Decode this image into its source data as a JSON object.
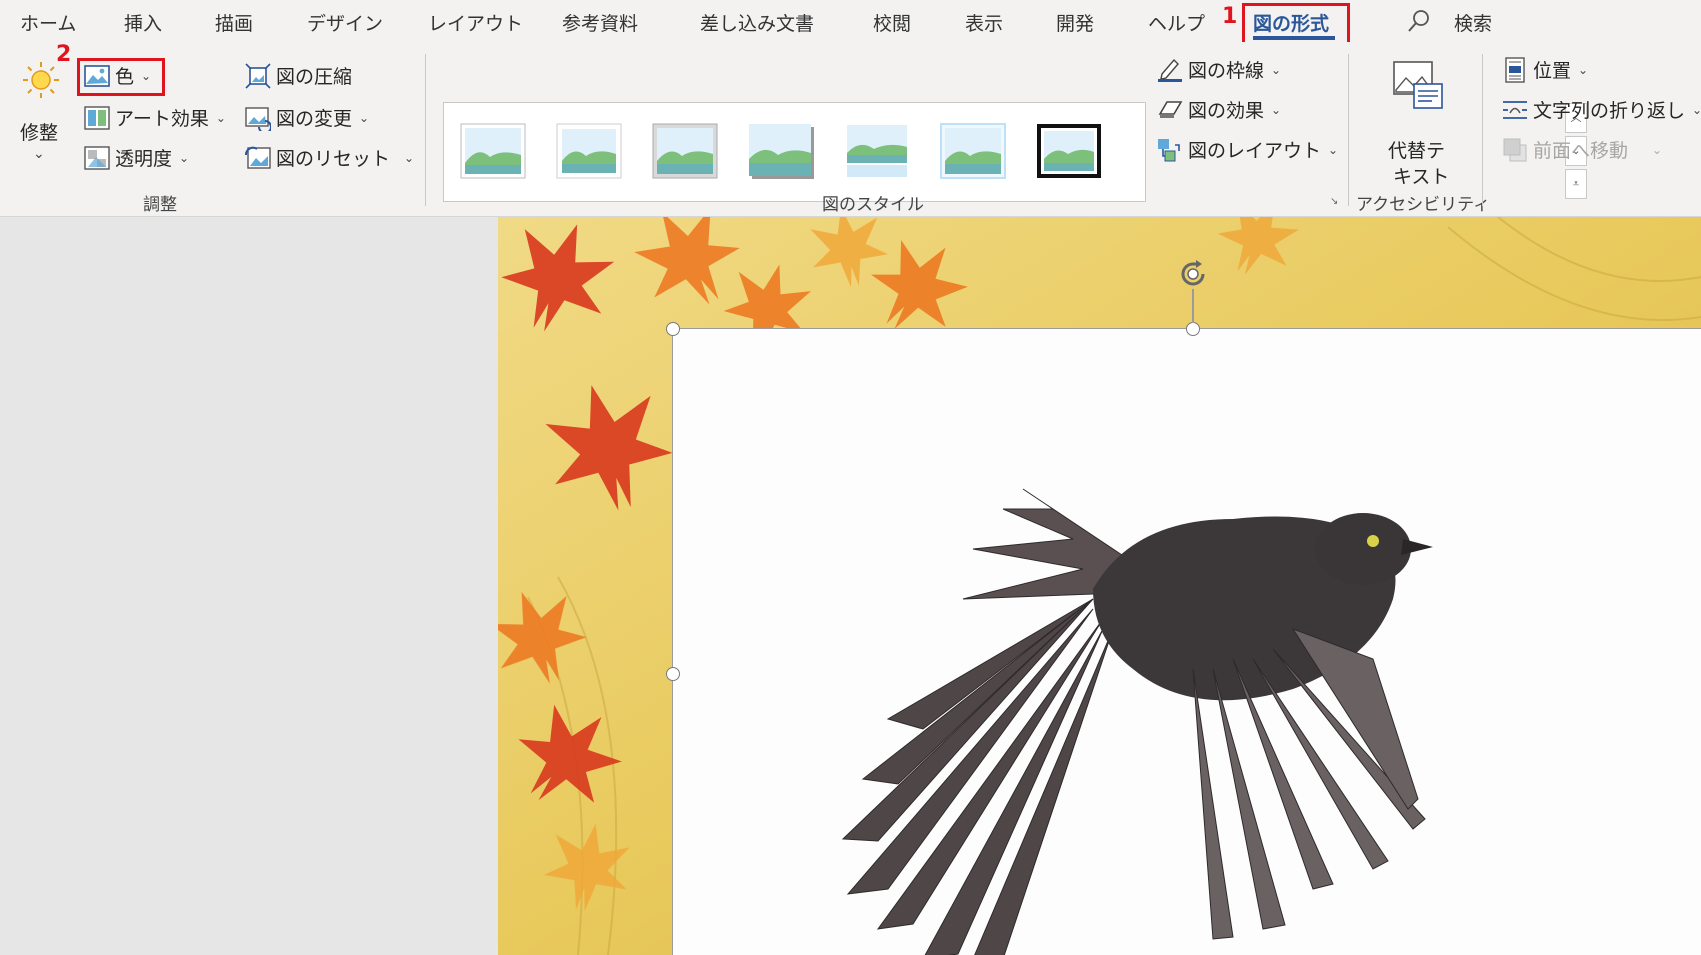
{
  "tabs": [
    {
      "label": "ホーム"
    },
    {
      "label": "挿入"
    },
    {
      "label": "描画"
    },
    {
      "label": "デザイン"
    },
    {
      "label": "レイアウト"
    },
    {
      "label": "参考資料"
    },
    {
      "label": "差し込み文書"
    },
    {
      "label": "校閲"
    },
    {
      "label": "表示"
    },
    {
      "label": "開発"
    },
    {
      "label": "ヘルプ"
    },
    {
      "label": "図の形式",
      "active": true
    }
  ],
  "search": {
    "label": "検索",
    "icon": "search-icon"
  },
  "annotations": {
    "step1": "1",
    "step2": "2",
    "highlight_color": "#e0141e"
  },
  "ribbon": {
    "adjust": {
      "corrections": {
        "line1": "修整",
        "chevron": "⌄"
      },
      "color": {
        "label": "色"
      },
      "artistic_effects": {
        "label": "アート効果"
      },
      "transparency": {
        "label": "透明度"
      },
      "compress": {
        "label": "図の圧縮"
      },
      "change_picture": {
        "label": "図の変更"
      },
      "reset_picture": {
        "label": "図のリセット"
      },
      "group_label": "調整"
    },
    "styles": {
      "group_label": "図のスタイル",
      "border": {
        "label": "図の枠線"
      },
      "effects": {
        "label": "図の効果"
      },
      "layout": {
        "label": "図のレイアウト"
      }
    },
    "accessibility": {
      "alt_text": {
        "line1": "代替テ",
        "line2": "キスト"
      },
      "group_label": "アクセシビリティ"
    },
    "arrange": {
      "position": {
        "label": "位置"
      },
      "wrap_text": {
        "label": "文字列の折り返し"
      },
      "bring_forward": {
        "label": "前面へ移動",
        "disabled": true
      }
    }
  },
  "colors": {
    "accent": "#2b579a",
    "ribbon_bg": "#f3f2f1",
    "canvas_bg": "#e6e6e6"
  }
}
